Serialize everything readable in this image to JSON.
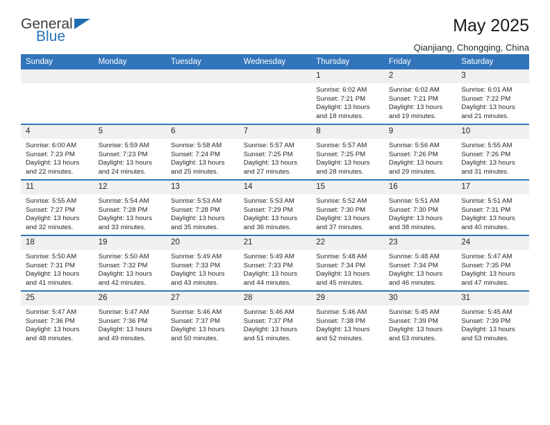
{
  "brand": {
    "name_top": "General",
    "name_bottom": "Blue",
    "triangle_color": "#1f6cb0",
    "blue_text_color": "#2572b8"
  },
  "header": {
    "title": "May 2025",
    "subtitle": "Qianjiang, Chongqing, China"
  },
  "theme": {
    "header_row_bg": "#3275bb",
    "daynum_bg": "#f0f0f0",
    "cell_border": "#3275bb",
    "text": "#262626"
  },
  "labels": {
    "sunrise_prefix": "Sunrise:",
    "sunset_prefix": "Sunset:",
    "daylight_prefix": "Daylight:"
  },
  "weekday_headers": [
    "Sunday",
    "Monday",
    "Tuesday",
    "Wednesday",
    "Thursday",
    "Friday",
    "Saturday"
  ],
  "weeks": [
    [
      {
        "day": "",
        "empty": true
      },
      {
        "day": "",
        "empty": true
      },
      {
        "day": "",
        "empty": true
      },
      {
        "day": "",
        "empty": true
      },
      {
        "day": "1",
        "sunrise": "Sunrise: 6:02 AM",
        "sunset": "Sunset: 7:21 PM",
        "daylight": "Daylight: 13 hours and 18 minutes."
      },
      {
        "day": "2",
        "sunrise": "Sunrise: 6:02 AM",
        "sunset": "Sunset: 7:21 PM",
        "daylight": "Daylight: 13 hours and 19 minutes."
      },
      {
        "day": "3",
        "sunrise": "Sunrise: 6:01 AM",
        "sunset": "Sunset: 7:22 PM",
        "daylight": "Daylight: 13 hours and 21 minutes."
      }
    ],
    [
      {
        "day": "4",
        "sunrise": "Sunrise: 6:00 AM",
        "sunset": "Sunset: 7:23 PM",
        "daylight": "Daylight: 13 hours and 22 minutes."
      },
      {
        "day": "5",
        "sunrise": "Sunrise: 5:59 AM",
        "sunset": "Sunset: 7:23 PM",
        "daylight": "Daylight: 13 hours and 24 minutes."
      },
      {
        "day": "6",
        "sunrise": "Sunrise: 5:58 AM",
        "sunset": "Sunset: 7:24 PM",
        "daylight": "Daylight: 13 hours and 25 minutes."
      },
      {
        "day": "7",
        "sunrise": "Sunrise: 5:57 AM",
        "sunset": "Sunset: 7:25 PM",
        "daylight": "Daylight: 13 hours and 27 minutes."
      },
      {
        "day": "8",
        "sunrise": "Sunrise: 5:57 AM",
        "sunset": "Sunset: 7:25 PM",
        "daylight": "Daylight: 13 hours and 28 minutes."
      },
      {
        "day": "9",
        "sunrise": "Sunrise: 5:56 AM",
        "sunset": "Sunset: 7:26 PM",
        "daylight": "Daylight: 13 hours and 29 minutes."
      },
      {
        "day": "10",
        "sunrise": "Sunrise: 5:55 AM",
        "sunset": "Sunset: 7:26 PM",
        "daylight": "Daylight: 13 hours and 31 minutes."
      }
    ],
    [
      {
        "day": "11",
        "sunrise": "Sunrise: 5:55 AM",
        "sunset": "Sunset: 7:27 PM",
        "daylight": "Daylight: 13 hours and 32 minutes."
      },
      {
        "day": "12",
        "sunrise": "Sunrise: 5:54 AM",
        "sunset": "Sunset: 7:28 PM",
        "daylight": "Daylight: 13 hours and 33 minutes."
      },
      {
        "day": "13",
        "sunrise": "Sunrise: 5:53 AM",
        "sunset": "Sunset: 7:28 PM",
        "daylight": "Daylight: 13 hours and 35 minutes."
      },
      {
        "day": "14",
        "sunrise": "Sunrise: 5:53 AM",
        "sunset": "Sunset: 7:29 PM",
        "daylight": "Daylight: 13 hours and 36 minutes."
      },
      {
        "day": "15",
        "sunrise": "Sunrise: 5:52 AM",
        "sunset": "Sunset: 7:30 PM",
        "daylight": "Daylight: 13 hours and 37 minutes."
      },
      {
        "day": "16",
        "sunrise": "Sunrise: 5:51 AM",
        "sunset": "Sunset: 7:30 PM",
        "daylight": "Daylight: 13 hours and 38 minutes."
      },
      {
        "day": "17",
        "sunrise": "Sunrise: 5:51 AM",
        "sunset": "Sunset: 7:31 PM",
        "daylight": "Daylight: 13 hours and 40 minutes."
      }
    ],
    [
      {
        "day": "18",
        "sunrise": "Sunrise: 5:50 AM",
        "sunset": "Sunset: 7:31 PM",
        "daylight": "Daylight: 13 hours and 41 minutes."
      },
      {
        "day": "19",
        "sunrise": "Sunrise: 5:50 AM",
        "sunset": "Sunset: 7:32 PM",
        "daylight": "Daylight: 13 hours and 42 minutes."
      },
      {
        "day": "20",
        "sunrise": "Sunrise: 5:49 AM",
        "sunset": "Sunset: 7:33 PM",
        "daylight": "Daylight: 13 hours and 43 minutes."
      },
      {
        "day": "21",
        "sunrise": "Sunrise: 5:49 AM",
        "sunset": "Sunset: 7:33 PM",
        "daylight": "Daylight: 13 hours and 44 minutes."
      },
      {
        "day": "22",
        "sunrise": "Sunrise: 5:48 AM",
        "sunset": "Sunset: 7:34 PM",
        "daylight": "Daylight: 13 hours and 45 minutes."
      },
      {
        "day": "23",
        "sunrise": "Sunrise: 5:48 AM",
        "sunset": "Sunset: 7:34 PM",
        "daylight": "Daylight: 13 hours and 46 minutes."
      },
      {
        "day": "24",
        "sunrise": "Sunrise: 5:47 AM",
        "sunset": "Sunset: 7:35 PM",
        "daylight": "Daylight: 13 hours and 47 minutes."
      }
    ],
    [
      {
        "day": "25",
        "sunrise": "Sunrise: 5:47 AM",
        "sunset": "Sunset: 7:36 PM",
        "daylight": "Daylight: 13 hours and 48 minutes."
      },
      {
        "day": "26",
        "sunrise": "Sunrise: 5:47 AM",
        "sunset": "Sunset: 7:36 PM",
        "daylight": "Daylight: 13 hours and 49 minutes."
      },
      {
        "day": "27",
        "sunrise": "Sunrise: 5:46 AM",
        "sunset": "Sunset: 7:37 PM",
        "daylight": "Daylight: 13 hours and 50 minutes."
      },
      {
        "day": "28",
        "sunrise": "Sunrise: 5:46 AM",
        "sunset": "Sunset: 7:37 PM",
        "daylight": "Daylight: 13 hours and 51 minutes."
      },
      {
        "day": "29",
        "sunrise": "Sunrise: 5:46 AM",
        "sunset": "Sunset: 7:38 PM",
        "daylight": "Daylight: 13 hours and 52 minutes."
      },
      {
        "day": "30",
        "sunrise": "Sunrise: 5:45 AM",
        "sunset": "Sunset: 7:39 PM",
        "daylight": "Daylight: 13 hours and 53 minutes."
      },
      {
        "day": "31",
        "sunrise": "Sunrise: 5:45 AM",
        "sunset": "Sunset: 7:39 PM",
        "daylight": "Daylight: 13 hours and 53 minutes."
      }
    ]
  ]
}
